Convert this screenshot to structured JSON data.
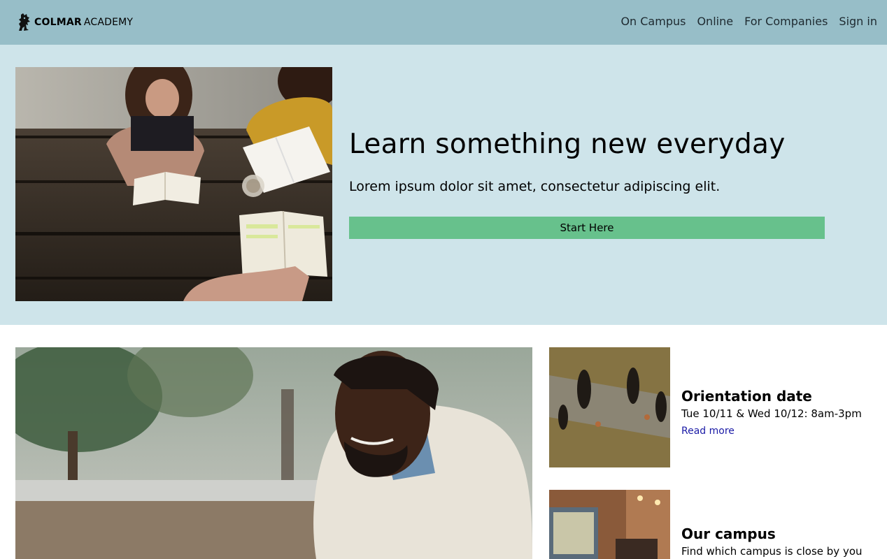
{
  "brand": {
    "name_bold": "COLMAR",
    "name_light": "ACADEMY",
    "logo_icon": "lion-icon"
  },
  "nav": {
    "items": [
      {
        "label": "On Campus"
      },
      {
        "label": "Online"
      },
      {
        "label": "For Companies"
      },
      {
        "label": "Sign in"
      }
    ]
  },
  "hero": {
    "title": "Learn something new everyday",
    "subtitle": "Lorem ipsum dolor sit amet, consectetur adipiscing elit.",
    "cta_label": "Start Here",
    "image": "photo-students-studying-at-table"
  },
  "feature": {
    "image": "photo-smiling-man-outdoors"
  },
  "cards": [
    {
      "title": "Orientation date",
      "text": "Tue 10/11 & Wed 10/12: 8am-3pm",
      "link": "Read more",
      "image": "photo-people-shadows-walking"
    },
    {
      "title": "Our campus",
      "text": "Find which campus is close by you",
      "image": "photo-campus-interior"
    }
  ],
  "colors": {
    "header_bg": "#97bec8",
    "hero_bg": "#cee4ea",
    "cta_bg": "#67c18c",
    "link": "#1a1aa6"
  }
}
